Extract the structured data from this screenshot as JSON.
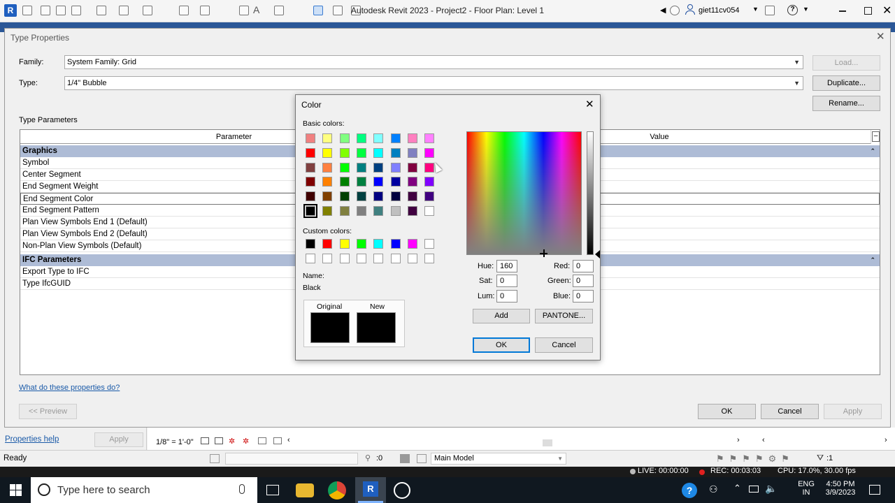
{
  "app": {
    "title": "Autodesk Revit 2023 - Project2 - Floor Plan: Level 1",
    "user": "giet11cv054",
    "logo_letter": "R"
  },
  "type_properties": {
    "title": "Type Properties",
    "family_label": "Family:",
    "family_value": "System Family: Grid",
    "type_label": "Type:",
    "type_value": "1/4\" Bubble",
    "load_button": "Load...",
    "duplicate_button": "Duplicate...",
    "rename_button": "Rename...",
    "section_label": "Type Parameters",
    "col_parameter": "Parameter",
    "col_value": "Value",
    "groups": [
      {
        "name": "Graphics",
        "rows": [
          "Symbol",
          "Center Segment",
          "End Segment Weight",
          "End Segment Color",
          "End Segment Pattern",
          "Plan View Symbols End 1 (Default)",
          "Plan View Symbols End 2 (Default)",
          "Non-Plan View Symbols (Default)"
        ]
      },
      {
        "name": "IFC Parameters",
        "rows": [
          "Export Type to IFC",
          "Type IfcGUID"
        ]
      }
    ],
    "help_link": "What do these properties do?",
    "preview_button": "<< Preview",
    "ok_button": "OK",
    "cancel_button": "Cancel",
    "apply_button": "Apply"
  },
  "color_dialog": {
    "title": "Color",
    "basic_colors_label": "Basic colors:",
    "custom_colors_label": "Custom colors:",
    "name_label": "Name:",
    "name_value": "Black",
    "original_label": "Original",
    "new_label": "New",
    "hue_label": "Hue:",
    "hue_value": "160",
    "sat_label": "Sat:",
    "sat_value": "0",
    "lum_label": "Lum:",
    "lum_value": "0",
    "red_label": "Red:",
    "red_value": "0",
    "green_label": "Green:",
    "green_value": "0",
    "blue_label": "Blue:",
    "blue_value": "0",
    "add_button": "Add",
    "pantone_button": "PANTONE...",
    "ok_button": "OK",
    "cancel_button": "Cancel",
    "basic_colors": [
      [
        "#f08080",
        "#ffff80",
        "#80ff80",
        "#00ff80",
        "#80ffff",
        "#0080ff",
        "#ff80c0",
        "#ff80ff"
      ],
      [
        "#ff0000",
        "#ffff00",
        "#80ff00",
        "#00ff40",
        "#00ffff",
        "#0080c0",
        "#8080c0",
        "#ff00ff"
      ],
      [
        "#804040",
        "#ff8040",
        "#00ff00",
        "#008080",
        "#004080",
        "#8080ff",
        "#800040",
        "#ff0080"
      ],
      [
        "#800000",
        "#ff8000",
        "#008000",
        "#008040",
        "#0000ff",
        "#0000a0",
        "#800080",
        "#8000ff"
      ],
      [
        "#400000",
        "#804000",
        "#004000",
        "#004040",
        "#000080",
        "#000040",
        "#400040",
        "#400080"
      ],
      [
        "#000000",
        "#808000",
        "#808040",
        "#808080",
        "#408080",
        "#c0c0c0",
        "#400040",
        "#ffffff"
      ]
    ],
    "custom_colors": [
      [
        "#000000",
        "#ff0000",
        "#ffff00",
        "#00ff00",
        "#00ffff",
        "#0000ff",
        "#ff00ff",
        "#ffffff"
      ],
      [
        "#ffffff",
        "#ffffff",
        "#ffffff",
        "#ffffff",
        "#ffffff",
        "#ffffff",
        "#ffffff",
        "#ffffff"
      ]
    ],
    "original_color": "#000000",
    "new_color": "#000000"
  },
  "properties_panel": {
    "help_link": "Properties help",
    "apply_button": "Apply"
  },
  "view_bar": {
    "scale": "1/8\" = 1'-0\""
  },
  "status": {
    "ready": "Ready",
    "selection_count": ":0",
    "model": "Main Model",
    "filter_count": ":1",
    "live": "LIVE: 00:00:00",
    "rec": "REC: 00:03:03",
    "cpu": "CPU: 17.0%, 30.00 fps"
  },
  "taskbar": {
    "search_placeholder": "Type here to search",
    "lang_top": "ENG",
    "lang_bottom": "IN",
    "time": "4:50 PM",
    "date": "3/9/2023"
  }
}
